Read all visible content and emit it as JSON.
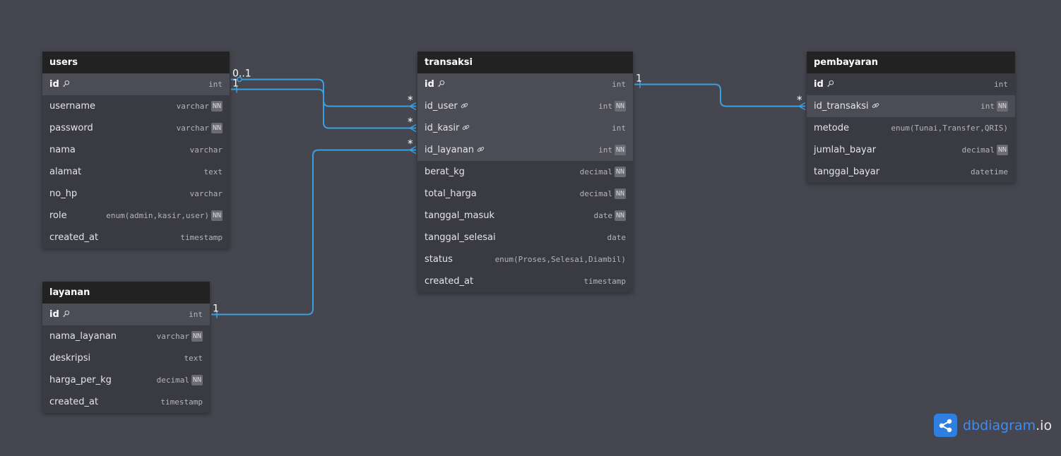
{
  "tables": [
    {
      "id": "users",
      "name": "users",
      "fields": [
        {
          "name": "id",
          "type": "int",
          "pk": true,
          "key_icon": "key-icon",
          "highlight": true
        },
        {
          "name": "username",
          "type": "varchar",
          "nn": true
        },
        {
          "name": "password",
          "type": "varchar",
          "nn": true
        },
        {
          "name": "nama",
          "type": "varchar"
        },
        {
          "name": "alamat",
          "type": "text"
        },
        {
          "name": "no_hp",
          "type": "varchar"
        },
        {
          "name": "role",
          "type": "enum(admin,kasir,user)",
          "nn": true
        },
        {
          "name": "created_at",
          "type": "timestamp"
        }
      ]
    },
    {
      "id": "layanan",
      "name": "layanan",
      "fields": [
        {
          "name": "id",
          "type": "int",
          "pk": true,
          "key_icon": "key-icon",
          "highlight": true
        },
        {
          "name": "nama_layanan",
          "type": "varchar",
          "nn": true
        },
        {
          "name": "deskripsi",
          "type": "text"
        },
        {
          "name": "harga_per_kg",
          "type": "decimal",
          "nn": true
        },
        {
          "name": "created_at",
          "type": "timestamp"
        }
      ]
    },
    {
      "id": "transaksi",
      "name": "transaksi",
      "fields": [
        {
          "name": "id",
          "type": "int",
          "pk": true,
          "key_icon": "key-icon",
          "highlight": true
        },
        {
          "name": "id_user",
          "type": "int",
          "fk": true,
          "nn": true,
          "highlight": true
        },
        {
          "name": "id_kasir",
          "type": "int",
          "fk": true,
          "highlight": true
        },
        {
          "name": "id_layanan",
          "type": "int",
          "fk": true,
          "nn": true,
          "highlight": true
        },
        {
          "name": "berat_kg",
          "type": "decimal",
          "nn": true
        },
        {
          "name": "total_harga",
          "type": "decimal",
          "nn": true
        },
        {
          "name": "tanggal_masuk",
          "type": "date",
          "nn": true
        },
        {
          "name": "tanggal_selesai",
          "type": "date"
        },
        {
          "name": "status",
          "type": "enum(Proses,Selesai,Diambil)"
        },
        {
          "name": "created_at",
          "type": "timestamp"
        }
      ]
    },
    {
      "id": "pembayaran",
      "name": "pembayaran",
      "fields": [
        {
          "name": "id",
          "type": "int",
          "pk": true,
          "key_icon": "key-icon",
          "highlight": false
        },
        {
          "name": "id_transaksi",
          "type": "int",
          "fk": true,
          "nn": true,
          "highlight": true
        },
        {
          "name": "metode",
          "type": "enum(Tunai,Transfer,QRIS)"
        },
        {
          "name": "jumlah_bayar",
          "type": "decimal",
          "nn": true
        },
        {
          "name": "tanggal_bayar",
          "type": "datetime"
        }
      ]
    }
  ],
  "nn_label": "NN",
  "relations": [
    {
      "from_table": "users",
      "from_field": "id",
      "from_label": "0..1",
      "to_table": "transaksi",
      "to_field": "id_user",
      "to_label": "*"
    },
    {
      "from_table": "users",
      "from_field": "id",
      "from_label": "1",
      "to_table": "transaksi",
      "to_field": "id_kasir",
      "to_label": "*"
    },
    {
      "from_table": "layanan",
      "from_field": "id",
      "from_label": "1",
      "to_table": "transaksi",
      "to_field": "id_layanan",
      "to_label": "*"
    },
    {
      "from_table": "transaksi",
      "from_field": "id",
      "from_label": "1",
      "to_table": "pembayaran",
      "to_field": "id_transaksi",
      "to_label": "*"
    }
  ],
  "colors": {
    "background": "#45464f",
    "table_header": "#222222",
    "table_body": "#393a42",
    "row_highlight": "#4b4c55",
    "link": "#3aa0e0",
    "logo": "#2f7fe0"
  },
  "branding": {
    "name": "dbdiagram",
    "tld": ".io",
    "logo_icon": "share-icon"
  }
}
